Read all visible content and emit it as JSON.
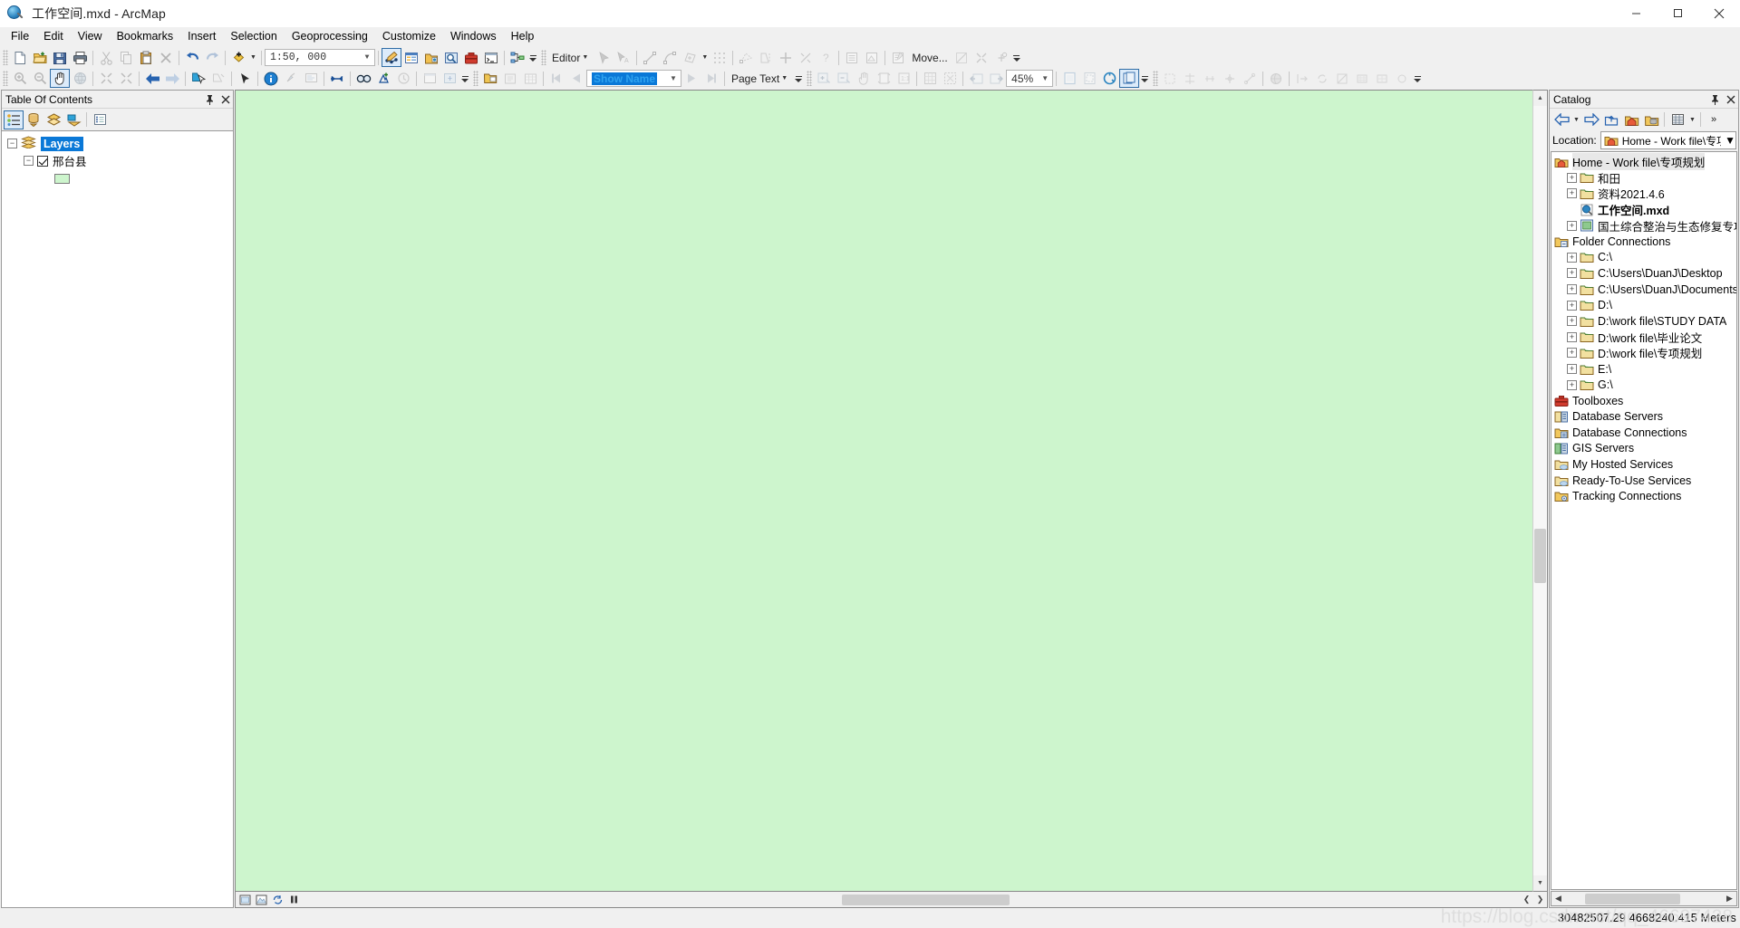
{
  "window": {
    "title": "工作空间.mxd - ArcMap",
    "app_icon": "arcmap-globe-icon",
    "minimize": "−",
    "maximize": "□",
    "close": "✕"
  },
  "menubar": {
    "items": [
      {
        "label": "File"
      },
      {
        "label": "Edit"
      },
      {
        "label": "View"
      },
      {
        "label": "Bookmarks"
      },
      {
        "label": "Insert"
      },
      {
        "label": "Selection"
      },
      {
        "label": "Geoprocessing"
      },
      {
        "label": "Customize"
      },
      {
        "label": "Windows"
      },
      {
        "label": "Help"
      }
    ]
  },
  "standard_toolbar": {
    "scale_value": "1:50, 000",
    "buttons": [
      {
        "name": "new-map-icon",
        "enabled": true
      },
      {
        "name": "open-icon",
        "enabled": true
      },
      {
        "name": "save-icon",
        "enabled": true
      },
      {
        "name": "print-icon",
        "enabled": true
      },
      {
        "name": "cut-icon",
        "enabled": false
      },
      {
        "name": "copy-icon",
        "enabled": false
      },
      {
        "name": "paste-icon",
        "enabled": true
      },
      {
        "name": "delete-icon",
        "enabled": false
      },
      {
        "name": "undo-icon",
        "enabled": true
      },
      {
        "name": "redo-icon",
        "enabled": false
      },
      {
        "name": "add-data-icon",
        "enabled": true
      }
    ],
    "right_buttons": [
      {
        "name": "editor-toolbar-icon",
        "enabled": true
      },
      {
        "name": "table-of-contents-icon",
        "enabled": true
      },
      {
        "name": "catalog-window-icon",
        "enabled": true
      },
      {
        "name": "search-window-icon",
        "enabled": true
      },
      {
        "name": "arctoolbox-icon",
        "enabled": true
      },
      {
        "name": "python-window-icon",
        "enabled": true
      },
      {
        "name": "model-builder-icon",
        "enabled": true
      }
    ]
  },
  "editor_toolbar": {
    "editor_label": "Editor",
    "move_label": "Move...",
    "buttons": [
      {
        "name": "edit-tool-icon"
      },
      {
        "name": "edit-annotation-tool-icon"
      },
      {
        "name": "straight-segment-icon"
      },
      {
        "name": "curve-segment-icon"
      },
      {
        "name": "construction-tool-icon"
      },
      {
        "name": "edit-vertices-icon"
      },
      {
        "name": "reshape-feature-icon"
      },
      {
        "name": "cut-polygons-icon"
      },
      {
        "name": "split-tool-icon"
      },
      {
        "name": "rotate-tool-icon"
      },
      {
        "name": "attributes-icon"
      },
      {
        "name": "sketch-properties-icon"
      },
      {
        "name": "create-features-icon"
      },
      {
        "name": "edit-sketch-properties-icon"
      },
      {
        "name": "merge-icon"
      },
      {
        "name": "snapping-icon"
      }
    ]
  },
  "layout_toolbar": {
    "page_text_label": "Page Text",
    "data_frame_value": "Show  Name",
    "zoom_value": "45%",
    "buttons": [
      {
        "name": "zoom-in-page-icon"
      },
      {
        "name": "zoom-out-page-icon"
      },
      {
        "name": "pan-page-icon"
      },
      {
        "name": "zoom-whole-page-icon"
      },
      {
        "name": "fixed-zoom-page-icon"
      },
      {
        "name": "zoom-to-100-icon"
      },
      {
        "name": "zoom-to-selected-icon"
      },
      {
        "name": "go-back-extent-icon"
      },
      {
        "name": "go-forward-extent-icon"
      },
      {
        "name": "toggle-draft-mode-icon"
      },
      {
        "name": "focus-data-frame-icon"
      },
      {
        "name": "change-layout-icon"
      },
      {
        "name": "data-driven-pages-icon"
      }
    ],
    "nav": [
      {
        "name": "first-page-icon"
      },
      {
        "name": "previous-page-icon"
      },
      {
        "name": "next-page-icon"
      },
      {
        "name": "last-page-icon"
      }
    ]
  },
  "tools_toolbar": {
    "buttons": [
      {
        "name": "zoom-in-icon"
      },
      {
        "name": "zoom-out-icon"
      },
      {
        "name": "pan-icon",
        "active": true
      },
      {
        "name": "full-extent-icon"
      },
      {
        "name": "fixed-zoom-in-icon"
      },
      {
        "name": "fixed-zoom-out-icon"
      },
      {
        "name": "go-back-icon"
      },
      {
        "name": "go-forward-icon"
      },
      {
        "name": "select-features-icon"
      },
      {
        "name": "clear-selection-icon"
      },
      {
        "name": "select-elements-icon"
      },
      {
        "name": "identify-icon"
      },
      {
        "name": "hyperlink-icon"
      },
      {
        "name": "html-popup-icon"
      },
      {
        "name": "measure-icon"
      },
      {
        "name": "find-icon"
      },
      {
        "name": "go-to-xy-icon"
      },
      {
        "name": "time-slider-icon"
      },
      {
        "name": "create-viewer-window-icon"
      },
      {
        "name": "scroll-map-icon"
      }
    ]
  },
  "toc_panel": {
    "title": "Table Of Contents",
    "pin_icon": "pin-icon",
    "close_icon": "close-icon",
    "toolbar": [
      {
        "name": "list-by-drawing-order-icon",
        "active": true
      },
      {
        "name": "list-by-source-icon",
        "active": false
      },
      {
        "name": "list-by-visibility-icon",
        "active": false
      },
      {
        "name": "list-by-selection-icon",
        "active": false
      },
      {
        "name": "options-icon",
        "active": false
      }
    ],
    "tree": {
      "root_label": "Layers",
      "root_selected": true,
      "layers": [
        {
          "label": "邢台县",
          "checked": true,
          "expanded": true,
          "symbol_color": "#cdf5cd"
        }
      ]
    }
  },
  "map": {
    "background_color": "#cdf5cd",
    "bottom_buttons": [
      {
        "name": "layout-view-icon"
      },
      {
        "name": "data-view-icon"
      },
      {
        "name": "refresh-view-icon"
      },
      {
        "name": "pause-drawing-icon"
      },
      {
        "name": "toggle-toc-icon"
      }
    ]
  },
  "catalog_panel": {
    "title": "Catalog",
    "pin_icon": "pin-icon",
    "close_icon": "close-icon",
    "toolbar": [
      {
        "name": "back-icon"
      },
      {
        "name": "back-dropdown-icon"
      },
      {
        "name": "forward-icon"
      },
      {
        "name": "up-one-level-icon"
      },
      {
        "name": "home-icon"
      },
      {
        "name": "default-geodatabase-icon"
      },
      {
        "name": "toggle-contents-panel-icon"
      },
      {
        "name": "contents-dropdown-icon"
      },
      {
        "name": "more-commands-icon"
      }
    ],
    "location": {
      "label": "Location:",
      "value": "Home - Work file\\专项",
      "icon": "home-folder-icon"
    },
    "tree": [
      {
        "label": "Home - Work file\\专项规划",
        "icon": "home-folder-icon",
        "indent": 0,
        "expandable": false,
        "selected": true,
        "bold": false
      },
      {
        "label": "和田",
        "icon": "folder-icon",
        "indent": 1,
        "expandable": true,
        "selected": false,
        "bold": false
      },
      {
        "label": "资料2021.4.6",
        "icon": "folder-icon",
        "indent": 1,
        "expandable": true,
        "selected": false,
        "bold": false
      },
      {
        "label": "工作空间.mxd",
        "icon": "mxd-icon",
        "indent": 1,
        "expandable": false,
        "selected": false,
        "bold": true
      },
      {
        "label": "国土综合整治与生态修复专项",
        "icon": "mxd-layout-icon",
        "indent": 1,
        "expandable": true,
        "selected": false,
        "bold": false
      },
      {
        "label": "Folder Connections",
        "icon": "folder-connections-icon",
        "indent": 0,
        "expandable": false,
        "selected": false,
        "bold": false
      },
      {
        "label": "C:\\",
        "icon": "folder-icon",
        "indent": 1,
        "expandable": true,
        "selected": false,
        "bold": false
      },
      {
        "label": "C:\\Users\\DuanJ\\Desktop",
        "icon": "folder-icon",
        "indent": 1,
        "expandable": true,
        "selected": false,
        "bold": false
      },
      {
        "label": "C:\\Users\\DuanJ\\Documents",
        "icon": "folder-icon",
        "indent": 1,
        "expandable": true,
        "selected": false,
        "bold": false
      },
      {
        "label": "D:\\",
        "icon": "folder-icon",
        "indent": 1,
        "expandable": true,
        "selected": false,
        "bold": false
      },
      {
        "label": "D:\\work file\\STUDY DATA",
        "icon": "folder-icon",
        "indent": 1,
        "expandable": true,
        "selected": false,
        "bold": false
      },
      {
        "label": "D:\\work file\\毕业论文",
        "icon": "folder-icon",
        "indent": 1,
        "expandable": true,
        "selected": false,
        "bold": false
      },
      {
        "label": "D:\\work file\\专项规划",
        "icon": "folder-icon",
        "indent": 1,
        "expandable": true,
        "selected": false,
        "bold": false
      },
      {
        "label": "E:\\",
        "icon": "folder-icon",
        "indent": 1,
        "expandable": true,
        "selected": false,
        "bold": false
      },
      {
        "label": "G:\\",
        "icon": "folder-icon",
        "indent": 1,
        "expandable": true,
        "selected": false,
        "bold": false
      },
      {
        "label": "Toolboxes",
        "icon": "toolboxes-icon",
        "indent": 0,
        "expandable": false,
        "selected": false,
        "bold": false
      },
      {
        "label": "Database Servers",
        "icon": "database-servers-icon",
        "indent": 0,
        "expandable": false,
        "selected": false,
        "bold": false
      },
      {
        "label": "Database Connections",
        "icon": "database-connections-icon",
        "indent": 0,
        "expandable": false,
        "selected": false,
        "bold": false
      },
      {
        "label": "GIS Servers",
        "icon": "gis-servers-icon",
        "indent": 0,
        "expandable": false,
        "selected": false,
        "bold": false
      },
      {
        "label": "My Hosted Services",
        "icon": "hosted-services-icon",
        "indent": 0,
        "expandable": false,
        "selected": false,
        "bold": false
      },
      {
        "label": "Ready-To-Use Services",
        "icon": "ready-to-use-services-icon",
        "indent": 0,
        "expandable": false,
        "selected": false,
        "bold": false
      },
      {
        "label": "Tracking Connections",
        "icon": "tracking-connections-icon",
        "indent": 0,
        "expandable": false,
        "selected": false,
        "bold": false
      }
    ]
  },
  "statusbar": {
    "coordinates": "30482507.29  4668240.415 Meters",
    "watermark": "https://blog.csdn.net/qq_46697428"
  },
  "colors": {
    "accent": "#0a78d7",
    "map_green": "#cdf5cd",
    "chrome": "#f0f0f0",
    "border": "#9a9a9a"
  }
}
